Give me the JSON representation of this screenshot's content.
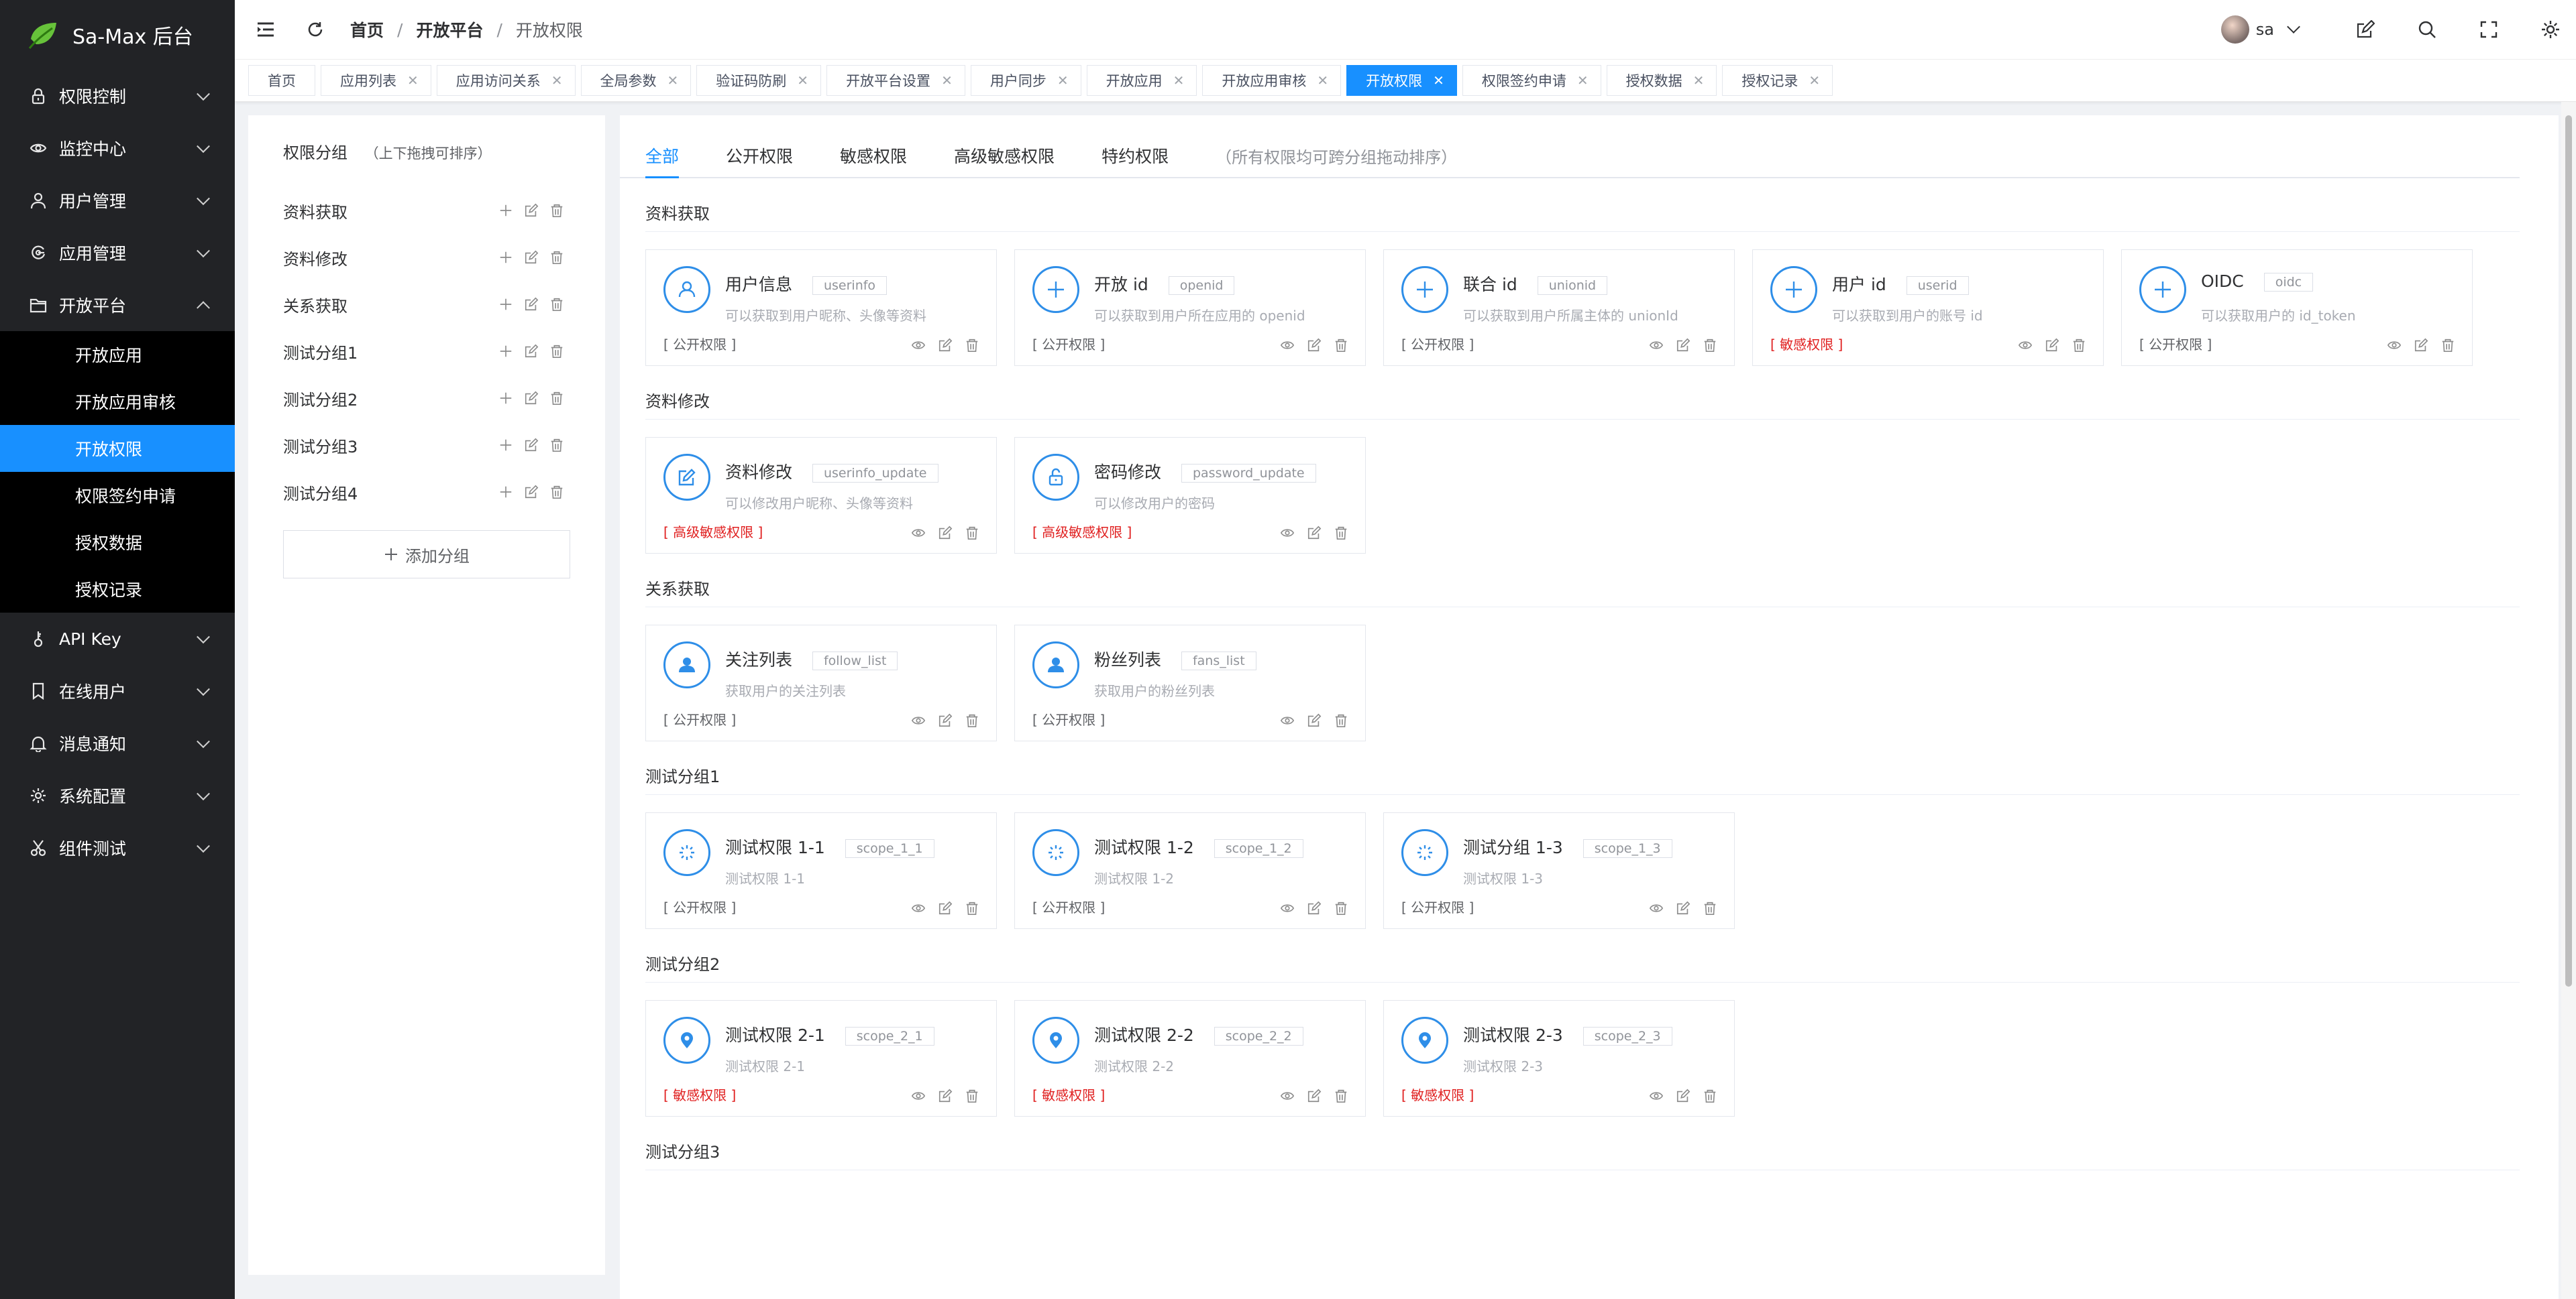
{
  "app": {
    "title": "Sa-Max 后台",
    "brand_color": "#1890ff",
    "sidebar_bg": "#222326"
  },
  "sidebar": {
    "items": [
      {
        "label": "权限控制",
        "icon": "lock-icon"
      },
      {
        "label": "监控中心",
        "icon": "eye-icon"
      },
      {
        "label": "用户管理",
        "icon": "user-icon"
      },
      {
        "label": "应用管理",
        "icon": "app-icon"
      },
      {
        "label": "开放平台",
        "icon": "folder-icon",
        "expanded": true
      }
    ],
    "open_platform_sub": [
      "开放应用",
      "开放应用审核",
      "开放权限",
      "权限签约申请",
      "授权数据",
      "授权记录"
    ],
    "active_sub": "开放权限",
    "items_after": [
      {
        "label": "API Key",
        "icon": "key-icon"
      },
      {
        "label": "在线用户",
        "icon": "bookmark-icon"
      },
      {
        "label": "消息通知",
        "icon": "bell-icon"
      },
      {
        "label": "系统配置",
        "icon": "gear-icon"
      },
      {
        "label": "组件测试",
        "icon": "scissors-icon"
      }
    ]
  },
  "header": {
    "breadcrumb": [
      "首页",
      "开放平台",
      "开放权限"
    ],
    "separator": "/",
    "user": "sa"
  },
  "tabs": [
    "首页",
    "应用列表",
    "应用访问关系",
    "全局参数",
    "验证码防刷",
    "开放平台设置",
    "用户同步",
    "开放应用",
    "开放应用审核",
    "开放权限",
    "权限签约申请",
    "授权数据",
    "授权记录"
  ],
  "active_tab": "开放权限",
  "groups_panel": {
    "title": "权限分组",
    "hint": "（上下拖拽可排序）",
    "groups": [
      "资料获取",
      "资料修改",
      "关系获取",
      "测试分组1",
      "测试分组2",
      "测试分组3",
      "测试分组4"
    ],
    "add_label": "添加分组"
  },
  "filter_tabs": [
    "全部",
    "公开权限",
    "敏感权限",
    "高级敏感权限",
    "特约权限"
  ],
  "filter_hint": "（所有权限均可跨分组拖动排序）",
  "sections": [
    {
      "title": "资料获取",
      "cards": [
        {
          "name": "用户信息",
          "code": "userinfo",
          "desc": "可以获取到用户昵称、头像等资料",
          "level": "[ 公开权限 ]",
          "sensitive": false,
          "icon": "person-outline-icon"
        },
        {
          "name": "开放 id",
          "code": "openid",
          "desc": "可以获取到用户所在应用的 openid",
          "level": "[ 公开权限 ]",
          "sensitive": false,
          "icon": "plus-circle-icon"
        },
        {
          "name": "联合 id",
          "code": "unionid",
          "desc": "可以获取到用户所属主体的 unionId",
          "level": "[ 公开权限 ]",
          "sensitive": false,
          "icon": "plus-circle-icon"
        },
        {
          "name": "用户 id",
          "code": "userid",
          "desc": "可以获取到用户的账号 id",
          "level": "[ 敏感权限 ]",
          "sensitive": true,
          "icon": "plus-circle-icon"
        },
        {
          "name": "OIDC",
          "code": "oidc",
          "desc": "可以获取用户的 id_token",
          "level": "[ 公开权限 ]",
          "sensitive": false,
          "icon": "plus-circle-icon"
        }
      ]
    },
    {
      "title": "资料修改",
      "cards": [
        {
          "name": "资料修改",
          "code": "userinfo_update",
          "desc": "可以修改用户昵称、头像等资料",
          "level": "[ 高级敏感权限 ]",
          "sensitive": true,
          "icon": "edit-icon"
        },
        {
          "name": "密码修改",
          "code": "password_update",
          "desc": "可以修改用户的密码",
          "level": "[ 高级敏感权限 ]",
          "sensitive": true,
          "icon": "unlock-icon"
        }
      ]
    },
    {
      "title": "关系获取",
      "cards": [
        {
          "name": "关注列表",
          "code": "follow_list",
          "desc": "获取用户的关注列表",
          "level": "[ 公开权限 ]",
          "sensitive": false,
          "icon": "person-filled-icon"
        },
        {
          "name": "粉丝列表",
          "code": "fans_list",
          "desc": "获取用户的粉丝列表",
          "level": "[ 公开权限 ]",
          "sensitive": false,
          "icon": "person-filled-icon"
        }
      ]
    },
    {
      "title": "测试分组1",
      "cards": [
        {
          "name": "测试权限 1-1",
          "code": "scope_1_1",
          "desc": "测试权限 1-1",
          "level": "[ 公开权限 ]",
          "sensitive": false,
          "icon": "loading-icon"
        },
        {
          "name": "测试权限 1-2",
          "code": "scope_1_2",
          "desc": "测试权限 1-2",
          "level": "[ 公开权限 ]",
          "sensitive": false,
          "icon": "loading-icon"
        },
        {
          "name": "测试分组 1-3",
          "code": "scope_1_3",
          "desc": "测试权限 1-3",
          "level": "[ 公开权限 ]",
          "sensitive": false,
          "icon": "loading-icon"
        }
      ]
    },
    {
      "title": "测试分组2",
      "cards": [
        {
          "name": "测试权限 2-1",
          "code": "scope_2_1",
          "desc": "测试权限 2-1",
          "level": "[ 敏感权限 ]",
          "sensitive": true,
          "icon": "location-icon"
        },
        {
          "name": "测试权限 2-2",
          "code": "scope_2_2",
          "desc": "测试权限 2-2",
          "level": "[ 敏感权限 ]",
          "sensitive": true,
          "icon": "location-icon"
        },
        {
          "name": "测试权限 2-3",
          "code": "scope_2_3",
          "desc": "测试权限 2-3",
          "level": "[ 敏感权限 ]",
          "sensitive": true,
          "icon": "location-icon"
        }
      ]
    },
    {
      "title": "测试分组3",
      "cards": []
    }
  ]
}
